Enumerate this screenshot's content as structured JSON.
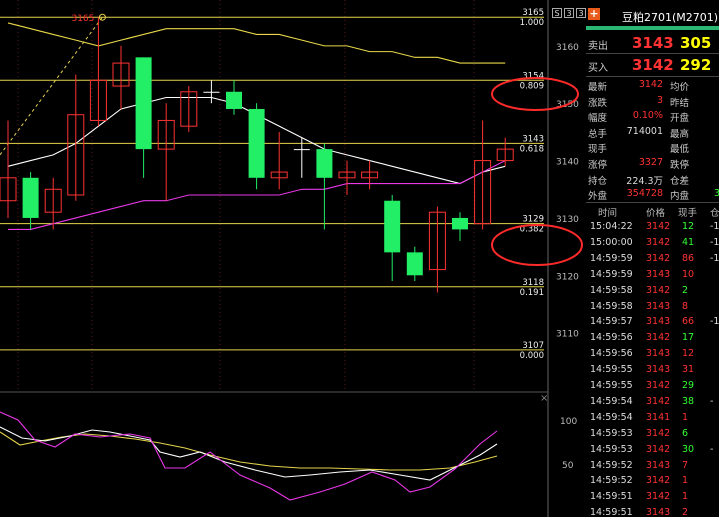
{
  "toolbar": {
    "btn_a": "S",
    "btn_b": "3",
    "btn_c": "3"
  },
  "chart_data": {
    "type": "candlestick",
    "ylim": [
      3100,
      3168
    ],
    "y_ticks": [
      3110,
      3120,
      3130,
      3140,
      3150,
      3160
    ],
    "fib_levels": [
      {
        "price": 3165,
        "ratio": "1.000",
        "label": "3165"
      },
      {
        "price": 3154,
        "ratio": "0.809",
        "label": "3154"
      },
      {
        "price": 3143,
        "ratio": "0.618",
        "label": "3143"
      },
      {
        "price": 3129,
        "ratio": "0.382",
        "label": "3129"
      },
      {
        "price": 3118,
        "ratio": "0.191",
        "label": "3118"
      },
      {
        "price": 3107,
        "ratio": "0.000",
        "label": "3107"
      }
    ],
    "high_marker": "3165",
    "candles": [
      {
        "o": 3133,
        "c": 3137,
        "h": 3147,
        "l": 3130
      },
      {
        "o": 3137,
        "c": 3130,
        "h": 3138,
        "l": 3128
      },
      {
        "o": 3131,
        "c": 3135,
        "h": 3137,
        "l": 3128
      },
      {
        "o": 3134,
        "c": 3148,
        "h": 3155,
        "l": 3133
      },
      {
        "o": 3147,
        "c": 3154,
        "h": 3165,
        "l": 3146
      },
      {
        "o": 3153,
        "c": 3157,
        "h": 3160,
        "l": 3149
      },
      {
        "o": 3158,
        "c": 3142,
        "h": 3158,
        "l": 3137
      },
      {
        "o": 3142,
        "c": 3147,
        "h": 3150,
        "l": 3133
      },
      {
        "o": 3146,
        "c": 3152,
        "h": 3153,
        "l": 3145
      },
      {
        "o": 3152,
        "c": 3152,
        "h": 3154,
        "l": 3150
      },
      {
        "o": 3152,
        "c": 3149,
        "h": 3154,
        "l": 3148
      },
      {
        "o": 3149,
        "c": 3137,
        "h": 3150,
        "l": 3135
      },
      {
        "o": 3137,
        "c": 3138,
        "h": 3145,
        "l": 3135
      },
      {
        "o": 3142,
        "c": 3142,
        "h": 3144,
        "l": 3137
      },
      {
        "o": 3142,
        "c": 3137,
        "h": 3143,
        "l": 3128
      },
      {
        "o": 3137,
        "c": 3138,
        "h": 3140,
        "l": 3134
      },
      {
        "o": 3137,
        "c": 3138,
        "h": 3140,
        "l": 3135
      },
      {
        "o": 3133,
        "c": 3124,
        "h": 3134,
        "l": 3119
      },
      {
        "o": 3124,
        "c": 3120,
        "h": 3125,
        "l": 3119
      },
      {
        "o": 3121,
        "c": 3131,
        "h": 3132,
        "l": 3117
      },
      {
        "o": 3130,
        "c": 3128,
        "h": 3131,
        "l": 3126
      },
      {
        "o": 3129,
        "c": 3140,
        "h": 3147,
        "l": 3128
      },
      {
        "o": 3140,
        "c": 3142,
        "h": 3144,
        "l": 3139
      }
    ],
    "upper_band": [
      3164,
      3163,
      3162,
      3161,
      3160,
      3161,
      3162,
      3163,
      3163,
      3163,
      3163,
      3162,
      3162,
      3161,
      3160,
      3160,
      3159,
      3159,
      3158,
      3158,
      3157,
      3157,
      3157
    ],
    "mid_band": [
      3139,
      3140,
      3141,
      3143,
      3146,
      3149,
      3150,
      3151,
      3151,
      3151,
      3150,
      3148,
      3146,
      3144,
      3142,
      3141,
      3140,
      3139,
      3138,
      3137,
      3136,
      3138,
      3139
    ],
    "lower_band": [
      3128,
      3128,
      3129,
      3130,
      3131,
      3132,
      3133,
      3133,
      3134,
      3134,
      3134,
      3134,
      3134,
      3135,
      3135,
      3136,
      3136,
      3136,
      3136,
      3136,
      3136,
      3138,
      3140
    ],
    "indicator_ticks": [
      "100",
      "50"
    ]
  },
  "quote": {
    "title": "豆粕2701(M2701)",
    "title_suffix": "°",
    "ask_label": "卖出",
    "ask_price": "3143",
    "ask_vol": "305",
    "bid_label": "买入",
    "bid_price": "3142",
    "bid_vol": "292",
    "stats": [
      {
        "k": "最新",
        "v": "3142",
        "vc": "red",
        "k2": "均价",
        "v2": "",
        "v2c": "red"
      },
      {
        "k": "涨跌",
        "v": "3",
        "vc": "red",
        "k2": "昨结",
        "v2": "",
        "v2c": "white"
      },
      {
        "k": "幅度",
        "v": "0.10%",
        "vc": "red",
        "k2": "开盘",
        "v2": "",
        "v2c": "red"
      },
      {
        "k": "总手",
        "v": "714001",
        "vc": "white",
        "k2": "最高",
        "v2": "",
        "v2c": "red"
      },
      {
        "k": "现手",
        "v": "",
        "vc": "white",
        "k2": "最低",
        "v2": "",
        "v2c": "green"
      },
      {
        "k": "涨停",
        "v": "3327",
        "vc": "red",
        "k2": "跌停",
        "v2": "",
        "v2c": "green"
      },
      {
        "k": "持仓",
        "v": "224.3万",
        "vc": "white",
        "k2": "仓差",
        "v2": "",
        "v2c": "white"
      },
      {
        "k": "外盘",
        "v": "354728",
        "vc": "red",
        "k2": "内盘",
        "v2": "3",
        "v2c": "green"
      }
    ],
    "ticks_header": {
      "time": "时间",
      "price": "价格",
      "vol": "现手",
      "pos": "仓"
    },
    "ticks": [
      {
        "t": "15:04:22",
        "p": "3142",
        "v": "12",
        "vc": "green",
        "x": "-1"
      },
      {
        "t": "15:00:00",
        "p": "3142",
        "v": "41",
        "vc": "green",
        "x": "-1"
      },
      {
        "t": "14:59:59",
        "p": "3142",
        "v": "86",
        "vc": "red",
        "x": "-1"
      },
      {
        "t": "14:59:59",
        "p": "3143",
        "v": "10",
        "vc": "red",
        "x": ""
      },
      {
        "t": "14:59:58",
        "p": "3142",
        "v": "2",
        "vc": "green",
        "x": ""
      },
      {
        "t": "14:59:58",
        "p": "3143",
        "v": "8",
        "vc": "red",
        "x": ""
      },
      {
        "t": "14:59:57",
        "p": "3143",
        "v": "66",
        "vc": "red",
        "x": "-1"
      },
      {
        "t": "14:59:56",
        "p": "3142",
        "v": "17",
        "vc": "green",
        "x": ""
      },
      {
        "t": "14:59:56",
        "p": "3143",
        "v": "12",
        "vc": "red",
        "x": ""
      },
      {
        "t": "14:59:55",
        "p": "3143",
        "v": "31",
        "vc": "red",
        "x": ""
      },
      {
        "t": "14:59:55",
        "p": "3142",
        "v": "29",
        "vc": "green",
        "x": ""
      },
      {
        "t": "14:59:54",
        "p": "3142",
        "v": "38",
        "vc": "green",
        "x": "-"
      },
      {
        "t": "14:59:54",
        "p": "3141",
        "v": "1",
        "vc": "red",
        "x": ""
      },
      {
        "t": "14:59:53",
        "p": "3142",
        "v": "6",
        "vc": "green",
        "x": ""
      },
      {
        "t": "14:59:53",
        "p": "3142",
        "v": "30",
        "vc": "green",
        "x": "-"
      },
      {
        "t": "14:59:52",
        "p": "3143",
        "v": "7",
        "vc": "red",
        "x": ""
      },
      {
        "t": "14:59:52",
        "p": "3142",
        "v": "1",
        "vc": "red",
        "x": ""
      },
      {
        "t": "14:59:51",
        "p": "3142",
        "v": "1",
        "vc": "red",
        "x": ""
      },
      {
        "t": "14:59:51",
        "p": "3143",
        "v": "2",
        "vc": "red",
        "x": ""
      }
    ]
  }
}
